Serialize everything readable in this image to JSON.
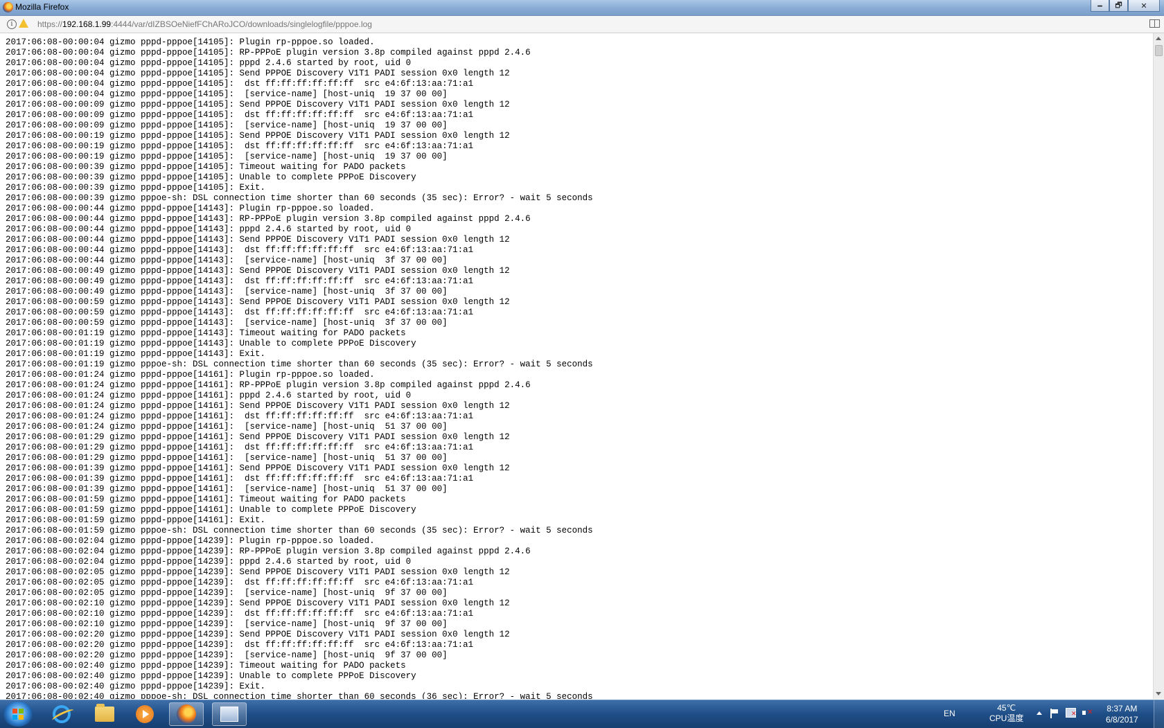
{
  "window": {
    "title": "Mozilla Firefox",
    "minimize_label": "🗕",
    "maximize_label": "🗗",
    "close_label": "✕"
  },
  "urlbar": {
    "scheme": "https://",
    "host": "192.168.1.99",
    "path": ":4444/var/dIZBSOeNiefFChARoJCO/downloads/singlelogfile/pppoe.log"
  },
  "log_lines": [
    "2017:06:08-00:00:04 gizmo pppd-pppoe[14105]: Plugin rp-pppoe.so loaded.",
    "2017:06:08-00:00:04 gizmo pppd-pppoe[14105]: RP-PPPoE plugin version 3.8p compiled against pppd 2.4.6",
    "2017:06:08-00:00:04 gizmo pppd-pppoe[14105]: pppd 2.4.6 started by root, uid 0",
    "2017:06:08-00:00:04 gizmo pppd-pppoe[14105]: Send PPPOE Discovery V1T1 PADI session 0x0 length 12",
    "2017:06:08-00:00:04 gizmo pppd-pppoe[14105]:  dst ff:ff:ff:ff:ff:ff  src e4:6f:13:aa:71:a1",
    "2017:06:08-00:00:04 gizmo pppd-pppoe[14105]:  [service-name] [host-uniq  19 37 00 00]",
    "2017:06:08-00:00:09 gizmo pppd-pppoe[14105]: Send PPPOE Discovery V1T1 PADI session 0x0 length 12",
    "2017:06:08-00:00:09 gizmo pppd-pppoe[14105]:  dst ff:ff:ff:ff:ff:ff  src e4:6f:13:aa:71:a1",
    "2017:06:08-00:00:09 gizmo pppd-pppoe[14105]:  [service-name] [host-uniq  19 37 00 00]",
    "2017:06:08-00:00:19 gizmo pppd-pppoe[14105]: Send PPPOE Discovery V1T1 PADI session 0x0 length 12",
    "2017:06:08-00:00:19 gizmo pppd-pppoe[14105]:  dst ff:ff:ff:ff:ff:ff  src e4:6f:13:aa:71:a1",
    "2017:06:08-00:00:19 gizmo pppd-pppoe[14105]:  [service-name] [host-uniq  19 37 00 00]",
    "2017:06:08-00:00:39 gizmo pppd-pppoe[14105]: Timeout waiting for PADO packets",
    "2017:06:08-00:00:39 gizmo pppd-pppoe[14105]: Unable to complete PPPoE Discovery",
    "2017:06:08-00:00:39 gizmo pppd-pppoe[14105]: Exit.",
    "2017:06:08-00:00:39 gizmo pppoe-sh: DSL connection time shorter than 60 seconds (35 sec): Error? - wait 5 seconds",
    "2017:06:08-00:00:44 gizmo pppd-pppoe[14143]: Plugin rp-pppoe.so loaded.",
    "2017:06:08-00:00:44 gizmo pppd-pppoe[14143]: RP-PPPoE plugin version 3.8p compiled against pppd 2.4.6",
    "2017:06:08-00:00:44 gizmo pppd-pppoe[14143]: pppd 2.4.6 started by root, uid 0",
    "2017:06:08-00:00:44 gizmo pppd-pppoe[14143]: Send PPPOE Discovery V1T1 PADI session 0x0 length 12",
    "2017:06:08-00:00:44 gizmo pppd-pppoe[14143]:  dst ff:ff:ff:ff:ff:ff  src e4:6f:13:aa:71:a1",
    "2017:06:08-00:00:44 gizmo pppd-pppoe[14143]:  [service-name] [host-uniq  3f 37 00 00]",
    "2017:06:08-00:00:49 gizmo pppd-pppoe[14143]: Send PPPOE Discovery V1T1 PADI session 0x0 length 12",
    "2017:06:08-00:00:49 gizmo pppd-pppoe[14143]:  dst ff:ff:ff:ff:ff:ff  src e4:6f:13:aa:71:a1",
    "2017:06:08-00:00:49 gizmo pppd-pppoe[14143]:  [service-name] [host-uniq  3f 37 00 00]",
    "2017:06:08-00:00:59 gizmo pppd-pppoe[14143]: Send PPPOE Discovery V1T1 PADI session 0x0 length 12",
    "2017:06:08-00:00:59 gizmo pppd-pppoe[14143]:  dst ff:ff:ff:ff:ff:ff  src e4:6f:13:aa:71:a1",
    "2017:06:08-00:00:59 gizmo pppd-pppoe[14143]:  [service-name] [host-uniq  3f 37 00 00]",
    "2017:06:08-00:01:19 gizmo pppd-pppoe[14143]: Timeout waiting for PADO packets",
    "2017:06:08-00:01:19 gizmo pppd-pppoe[14143]: Unable to complete PPPoE Discovery",
    "2017:06:08-00:01:19 gizmo pppd-pppoe[14143]: Exit.",
    "2017:06:08-00:01:19 gizmo pppoe-sh: DSL connection time shorter than 60 seconds (35 sec): Error? - wait 5 seconds",
    "2017:06:08-00:01:24 gizmo pppd-pppoe[14161]: Plugin rp-pppoe.so loaded.",
    "2017:06:08-00:01:24 gizmo pppd-pppoe[14161]: RP-PPPoE plugin version 3.8p compiled against pppd 2.4.6",
    "2017:06:08-00:01:24 gizmo pppd-pppoe[14161]: pppd 2.4.6 started by root, uid 0",
    "2017:06:08-00:01:24 gizmo pppd-pppoe[14161]: Send PPPOE Discovery V1T1 PADI session 0x0 length 12",
    "2017:06:08-00:01:24 gizmo pppd-pppoe[14161]:  dst ff:ff:ff:ff:ff:ff  src e4:6f:13:aa:71:a1",
    "2017:06:08-00:01:24 gizmo pppd-pppoe[14161]:  [service-name] [host-uniq  51 37 00 00]",
    "2017:06:08-00:01:29 gizmo pppd-pppoe[14161]: Send PPPOE Discovery V1T1 PADI session 0x0 length 12",
    "2017:06:08-00:01:29 gizmo pppd-pppoe[14161]:  dst ff:ff:ff:ff:ff:ff  src e4:6f:13:aa:71:a1",
    "2017:06:08-00:01:29 gizmo pppd-pppoe[14161]:  [service-name] [host-uniq  51 37 00 00]",
    "2017:06:08-00:01:39 gizmo pppd-pppoe[14161]: Send PPPOE Discovery V1T1 PADI session 0x0 length 12",
    "2017:06:08-00:01:39 gizmo pppd-pppoe[14161]:  dst ff:ff:ff:ff:ff:ff  src e4:6f:13:aa:71:a1",
    "2017:06:08-00:01:39 gizmo pppd-pppoe[14161]:  [service-name] [host-uniq  51 37 00 00]",
    "2017:06:08-00:01:59 gizmo pppd-pppoe[14161]: Timeout waiting for PADO packets",
    "2017:06:08-00:01:59 gizmo pppd-pppoe[14161]: Unable to complete PPPoE Discovery",
    "2017:06:08-00:01:59 gizmo pppd-pppoe[14161]: Exit.",
    "2017:06:08-00:01:59 gizmo pppoe-sh: DSL connection time shorter than 60 seconds (35 sec): Error? - wait 5 seconds",
    "2017:06:08-00:02:04 gizmo pppd-pppoe[14239]: Plugin rp-pppoe.so loaded.",
    "2017:06:08-00:02:04 gizmo pppd-pppoe[14239]: RP-PPPoE plugin version 3.8p compiled against pppd 2.4.6",
    "2017:06:08-00:02:04 gizmo pppd-pppoe[14239]: pppd 2.4.6 started by root, uid 0",
    "2017:06:08-00:02:05 gizmo pppd-pppoe[14239]: Send PPPOE Discovery V1T1 PADI session 0x0 length 12",
    "2017:06:08-00:02:05 gizmo pppd-pppoe[14239]:  dst ff:ff:ff:ff:ff:ff  src e4:6f:13:aa:71:a1",
    "2017:06:08-00:02:05 gizmo pppd-pppoe[14239]:  [service-name] [host-uniq  9f 37 00 00]",
    "2017:06:08-00:02:10 gizmo pppd-pppoe[14239]: Send PPPOE Discovery V1T1 PADI session 0x0 length 12",
    "2017:06:08-00:02:10 gizmo pppd-pppoe[14239]:  dst ff:ff:ff:ff:ff:ff  src e4:6f:13:aa:71:a1",
    "2017:06:08-00:02:10 gizmo pppd-pppoe[14239]:  [service-name] [host-uniq  9f 37 00 00]",
    "2017:06:08-00:02:20 gizmo pppd-pppoe[14239]: Send PPPOE Discovery V1T1 PADI session 0x0 length 12",
    "2017:06:08-00:02:20 gizmo pppd-pppoe[14239]:  dst ff:ff:ff:ff:ff:ff  src e4:6f:13:aa:71:a1",
    "2017:06:08-00:02:20 gizmo pppd-pppoe[14239]:  [service-name] [host-uniq  9f 37 00 00]",
    "2017:06:08-00:02:40 gizmo pppd-pppoe[14239]: Timeout waiting for PADO packets",
    "2017:06:08-00:02:40 gizmo pppd-pppoe[14239]: Unable to complete PPPoE Discovery",
    "2017:06:08-00:02:40 gizmo pppd-pppoe[14239]: Exit.",
    "2017:06:08-00:02:40 gizmo pppoe-sh: DSL connection time shorter than 60 seconds (36 sec): Error? - wait 5 seconds"
  ],
  "taskbar": {
    "language": "EN",
    "temperature": "45℃",
    "cpu_label": "CPU温度",
    "time": "8:37 AM",
    "date": "6/8/2017"
  }
}
